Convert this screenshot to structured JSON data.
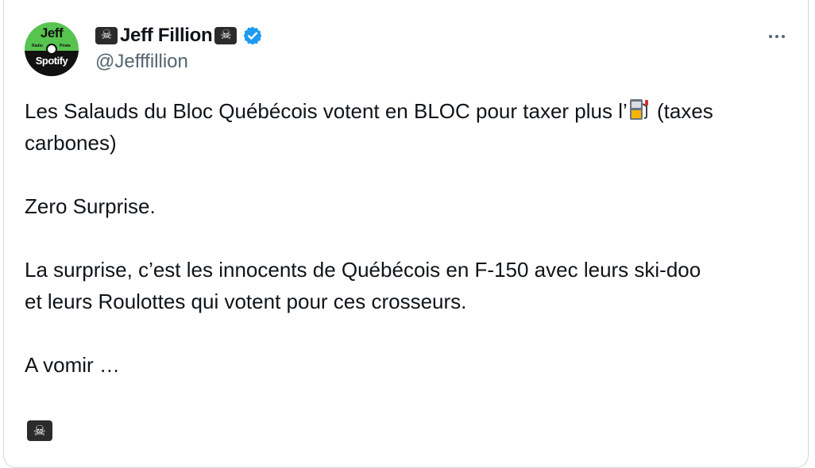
{
  "tweet": {
    "avatar": {
      "line1": "Jeff",
      "line2": "Spotify",
      "tiny_left": "Radio",
      "tiny_right": "Pirate"
    },
    "display_name": "Jeff Fillion",
    "handle": "@Jefffillion",
    "more_label": "More",
    "text": {
      "line1_before": "Les Salauds du Bloc Québécois votent en BLOC pour taxer plus l’",
      "line1_after": " (taxes",
      "line2": "carbones)",
      "line3": "Zero  Surprise.",
      "line4": "La surprise, c’est les innocents de Québécois en F-150 avec leurs ski-doo",
      "line5": "et leurs Roulottes qui votent pour ces crosseurs.",
      "line6": "A vomir …"
    },
    "icons": {
      "name_prefix": "pirate-flag-icon",
      "name_suffix": "pirate-flag-icon",
      "verified": "verified-badge-icon",
      "fuel": "fuel-pump-icon",
      "trailing": "pirate-flag-icon"
    },
    "colors": {
      "verified": "#1d9bf0",
      "handle": "#536471",
      "text": "#0f1419",
      "border": "#cfd9de"
    }
  }
}
